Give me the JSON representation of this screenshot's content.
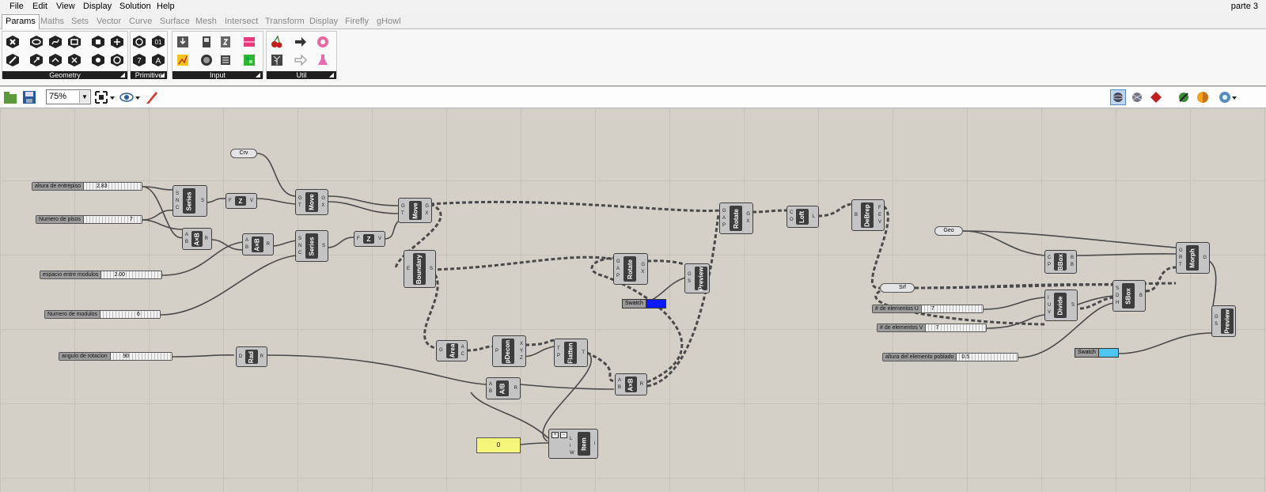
{
  "menu": {
    "items": [
      "File",
      "Edit",
      "View",
      "Display",
      "Solution",
      "Help"
    ],
    "document": "parte 3"
  },
  "tabs": [
    "Params",
    "Maths",
    "Sets",
    "Vector",
    "Curve",
    "Surface",
    "Mesh",
    "Intersect",
    "Transform",
    "Display",
    "Firefly",
    "gHowl"
  ],
  "ribbon": {
    "groups": [
      "Geometry",
      "Primitive",
      "Input",
      "Util"
    ]
  },
  "toolbar": {
    "zoom": "75%"
  },
  "sliders": {
    "altura": {
      "label": "altura de entrepiso",
      "value": "2.83"
    },
    "pisos": {
      "label": "Numero de pisos",
      "value": "7"
    },
    "espacio": {
      "label": "espacio entre modulos",
      "value": "2.00"
    },
    "modulos": {
      "label": "Numero de modulos",
      "value": "6"
    },
    "angulo": {
      "label": "angulo de rotacion",
      "value": "90"
    },
    "elemU": {
      "label": "# de elementos U",
      "value": "7"
    },
    "elemV": {
      "label": "# de elementos V",
      "value": "7"
    },
    "alturaElem": {
      "label": "altura del elemento poblado",
      "value": "0.5"
    }
  },
  "params": {
    "crv": "Crv",
    "srf": "Srf",
    "geo": "Geo",
    "panel_value": "0"
  },
  "swatches": {
    "s1": {
      "label": "Swatch",
      "color": "#0a1aff"
    },
    "s2": {
      "label": "Swatch",
      "color": "#4fc6f0"
    }
  },
  "components": {
    "series1": {
      "name": "Series",
      "in": [
        "S",
        "N",
        "C"
      ],
      "out": [
        "S"
      ]
    },
    "z1": {
      "name": "Z",
      "in": [
        "F"
      ],
      "out": [
        "V"
      ]
    },
    "move1": {
      "name": "Move",
      "in": [
        "G",
        "T"
      ],
      "out": [
        "G",
        "X"
      ]
    },
    "ab1": {
      "name": "A×B",
      "in": [
        "A",
        "B"
      ],
      "out": [
        "R"
      ]
    },
    "ab2": {
      "name": "A×B",
      "in": [
        "A",
        "B"
      ],
      "out": [
        "R"
      ]
    },
    "series2": {
      "name": "Series",
      "in": [
        "S",
        "N",
        "C"
      ],
      "out": [
        "S"
      ]
    },
    "z2": {
      "name": "Z",
      "in": [
        "F"
      ],
      "out": [
        "V"
      ]
    },
    "move2": {
      "name": "Move",
      "in": [
        "G",
        "T"
      ],
      "out": [
        "G",
        "X"
      ]
    },
    "boundary": {
      "name": "Boundary",
      "in": [
        "E"
      ],
      "out": [
        "S"
      ]
    },
    "rad": {
      "name": "Rad",
      "in": [
        "D"
      ],
      "out": [
        "R"
      ]
    },
    "area": {
      "name": "Area",
      "in": [
        "G"
      ],
      "out": [
        "A",
        "C"
      ]
    },
    "pdecon": {
      "name": "pDecon",
      "in": [
        "P"
      ],
      "out": [
        "X",
        "Y",
        "Z"
      ]
    },
    "flatten": {
      "name": "Flatten",
      "in": [
        "T",
        "P"
      ],
      "out": [
        "T"
      ]
    },
    "adivb": {
      "name": "A/B",
      "in": [
        "A",
        "B"
      ],
      "out": [
        "R"
      ]
    },
    "ab3": {
      "name": "A×B",
      "in": [
        "A",
        "B"
      ],
      "out": [
        "R"
      ]
    },
    "item": {
      "name": "Item",
      "in": [
        "L",
        "i",
        "W"
      ],
      "out": [
        "i"
      ]
    },
    "rotate1": {
      "name": "Rotate",
      "in": [
        "G",
        "A",
        "P"
      ],
      "out": [
        "G",
        "X"
      ]
    },
    "preview1": {
      "name": "Preview",
      "in": [
        "G",
        "S"
      ],
      "out": []
    },
    "rotate2": {
      "name": "Rotate",
      "in": [
        "G",
        "A",
        "P"
      ],
      "out": [
        "G",
        "X"
      ]
    },
    "loft": {
      "name": "Loft",
      "in": [
        "C",
        "O"
      ],
      "out": [
        "L"
      ]
    },
    "debrep": {
      "name": "DeBrep",
      "in": [
        "B"
      ],
      "out": [
        "F",
        "E",
        "V"
      ]
    },
    "bbox": {
      "name": "BBox",
      "in": [
        "C",
        "P"
      ],
      "out": [
        "B",
        "B"
      ]
    },
    "morph": {
      "name": "Morph",
      "in": [
        "G",
        "R",
        "T"
      ],
      "out": [
        "G"
      ]
    },
    "divide": {
      "name": "Divide",
      "in": [
        "I",
        "U",
        "V"
      ],
      "out": [
        "S"
      ]
    },
    "sbox": {
      "name": "SBox",
      "in": [
        "S",
        "D",
        "H"
      ],
      "out": [
        "B"
      ]
    },
    "preview2": {
      "name": "Preview",
      "in": [
        "G",
        "S"
      ],
      "out": []
    }
  }
}
